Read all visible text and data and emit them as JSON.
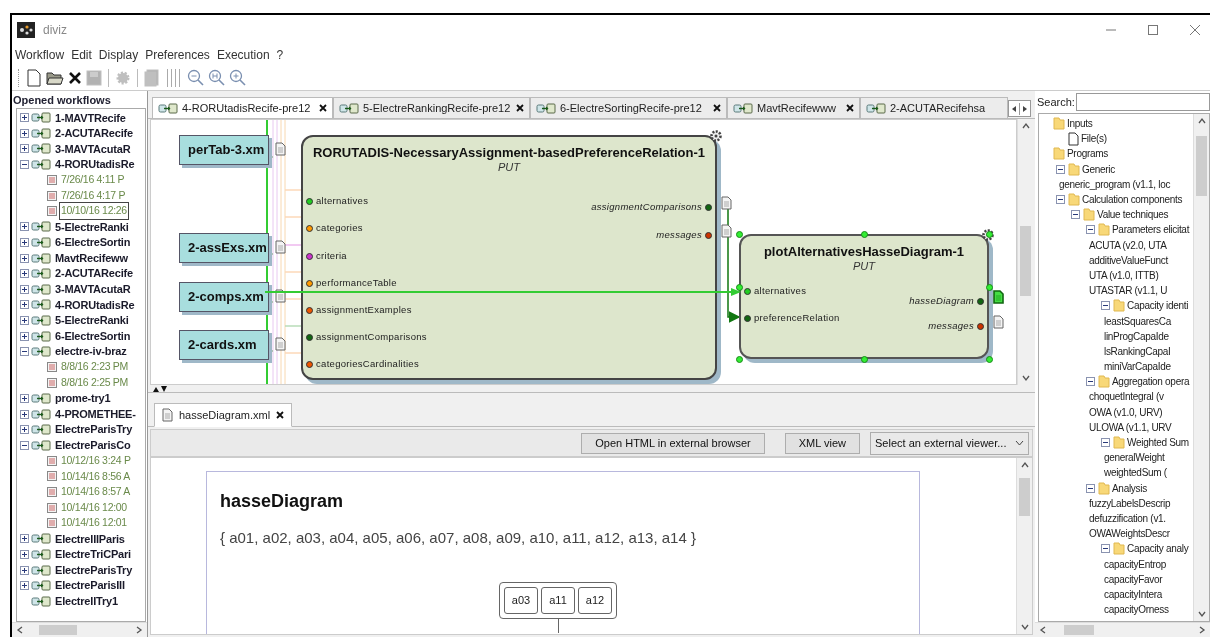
{
  "window": {
    "title": "diviz"
  },
  "menu": [
    "Workflow",
    "Edit",
    "Display",
    "Preferences",
    "Execution",
    "?"
  ],
  "toolbar": [
    {
      "kind": "new",
      "disabled": false
    },
    {
      "kind": "open",
      "disabled": false
    },
    {
      "kind": "close",
      "disabled": false
    },
    {
      "kind": "save",
      "disabled": true
    },
    {
      "kind": "run",
      "disabled": true
    },
    {
      "kind": "stamp",
      "disabled": true
    },
    {
      "kind": "zoom_out",
      "disabled": false
    },
    {
      "kind": "zoom_reset",
      "disabled": false
    },
    {
      "kind": "zoom_in",
      "disabled": false
    }
  ],
  "workflows": {
    "title": "Opened workflows",
    "items": [
      {
        "label": "1-MAVTRecife",
        "expanded": false
      },
      {
        "label": "2-ACUTARecife",
        "expanded": false
      },
      {
        "label": "3-MAVTAcutaR",
        "expanded": false
      },
      {
        "label": "4-RORUtadisRe",
        "expanded": true,
        "children": [
          {
            "label": "7/26/16 4:11 P",
            "selected": false
          },
          {
            "label": "7/26/16 4:17 P",
            "selected": false
          },
          {
            "label": "10/10/16 12:26",
            "selected": true
          }
        ]
      },
      {
        "label": "5-ElectreRanki",
        "expanded": false
      },
      {
        "label": "6-ElectreSortin",
        "expanded": false
      },
      {
        "label": "MavtRecifeww",
        "expanded": false
      },
      {
        "label": "2-ACUTARecife",
        "expanded": false
      },
      {
        "label": "3-MAVTAcutaR",
        "expanded": false
      },
      {
        "label": "4-RORUtadisRe",
        "expanded": false
      },
      {
        "label": "5-ElectreRanki",
        "expanded": false
      },
      {
        "label": "6-ElectreSortin",
        "expanded": false
      },
      {
        "label": "electre-iv-braz",
        "expanded": true,
        "children": [
          {
            "label": "8/8/16 2:23 PM",
            "selected": false
          },
          {
            "label": "8/8/16 2:25 PM",
            "selected": false
          }
        ]
      },
      {
        "label": "prome-try1",
        "expanded": false
      },
      {
        "label": "4-PROMETHEE-",
        "expanded": false
      },
      {
        "label": "ElectreParisTry",
        "expanded": false
      },
      {
        "label": "ElectreParisCo",
        "expanded": true,
        "children": [
          {
            "label": "10/12/16 3:24 P",
            "selected": false
          },
          {
            "label": "10/14/16 8:56 A",
            "selected": false
          },
          {
            "label": "10/14/16 8:57 A",
            "selected": false
          },
          {
            "label": "10/14/16 12:00",
            "selected": false
          },
          {
            "label": "10/14/16 12:01",
            "selected": false
          }
        ]
      },
      {
        "label": "ElectreIIIParis",
        "expanded": false
      },
      {
        "label": "ElectreTriCPari",
        "expanded": false
      },
      {
        "label": "ElectreParisTry",
        "expanded": false
      },
      {
        "label": "ElectreParisIII",
        "expanded": false
      },
      {
        "label": "ElectreIITry1"
      }
    ]
  },
  "editor": {
    "tabs": [
      {
        "label": "4-RORUtadisRecife-pre12",
        "selected": true,
        "closable": true
      },
      {
        "label": "5-ElectreRankingRecife-pre12",
        "selected": false,
        "closable": true
      },
      {
        "label": "6-ElectreSortingRecife-pre12",
        "selected": false,
        "closable": true
      },
      {
        "label": "MavtRecifewww",
        "selected": false,
        "closable": true
      },
      {
        "label": "2-ACUTARecifehsa",
        "selected": false,
        "closable": false
      }
    ]
  },
  "canvas": {
    "files": [
      {
        "label": "perTab-3.xm"
      },
      {
        "label": "2-assExs.xm"
      },
      {
        "label": "2-comps.xm"
      },
      {
        "label": "2-cards.xm"
      }
    ],
    "nodes": [
      {
        "title": "RORUTADIS-NecessaryAssignment-basedPreferenceRelation-1",
        "subtitle": "PUT",
        "selected": false,
        "inputs": [
          {
            "label": "alternatives",
            "color": "#22cc22"
          },
          {
            "label": "categories",
            "color": "#ff9900"
          },
          {
            "label": "criteria",
            "color": "#cc33cc"
          },
          {
            "label": "performanceTable",
            "color": "#ff9900"
          },
          {
            "label": "assignmentExamples",
            "color": "#ee5500"
          },
          {
            "label": "assignmentComparisons",
            "color": "#116611"
          },
          {
            "label": "categoriesCardinalities",
            "color": "#ee5500"
          }
        ],
        "outputs": [
          {
            "label": "assignmentComparisons",
            "color": "#116611",
            "selected": false
          },
          {
            "label": "messages",
            "color": "#cc3300",
            "selected": false
          }
        ]
      },
      {
        "title": "plotAlternativesHasseDiagram-1",
        "subtitle": "PUT",
        "selected": true,
        "inputs": [
          {
            "label": "alternatives",
            "color": "#22cc22"
          },
          {
            "label": "preferenceRelation",
            "color": "#116611"
          }
        ],
        "outputs": [
          {
            "label": "hasseDiagram",
            "color": "#116611",
            "selected": true
          },
          {
            "label": "messages",
            "color": "#cc3300",
            "selected": false
          }
        ]
      }
    ]
  },
  "viewer": {
    "tabs": [
      {
        "label": "hasseDiagram.xml",
        "selected": true
      }
    ],
    "buttons": [
      "Open HTML in external browser",
      "XML view"
    ],
    "viewer_select": {
      "value": "Select an external viewer..."
    }
  },
  "document": {
    "heading": "hasseDiagram",
    "set": "{ a01, a02, a03, a04, a05, a06, a07, a08, a09, a10, a11, a12, a13, a14 }",
    "diagram_nodes": [
      "a03",
      "a11",
      "a12"
    ]
  },
  "programs": {
    "search_label": "Search:",
    "items": [
      {
        "label": "Inputs",
        "kind": "folder",
        "children": [
          {
            "label": "File(s)",
            "kind": "file"
          }
        ]
      },
      {
        "label": "Programs",
        "kind": "folder",
        "children": [
          {
            "label": "Generic",
            "kind": "folder",
            "expanded": true,
            "children": [
              {
                "label": "generic_program (v1.1, loc",
                "kind": "program"
              }
            ]
          },
          {
            "label": "Calculation components",
            "kind": "folder",
            "expanded": true,
            "children": [
              {
                "label": "Value techniques",
                "kind": "folder",
                "expanded": true,
                "children": [
                  {
                    "label": "Parameters elicitat",
                    "kind": "folder",
                    "expanded": true,
                    "children": [
                      {
                        "label": "ACUTA (v2.0, UTA",
                        "kind": "program"
                      },
                      {
                        "label": "additiveValueFunct",
                        "kind": "program"
                      },
                      {
                        "label": "UTA (v1.0, ITTB)",
                        "kind": "program"
                      },
                      {
                        "label": "UTASTAR (v1.1, U",
                        "kind": "program"
                      },
                      {
                        "label": "Capacity identi",
                        "kind": "folder",
                        "expanded": true,
                        "children": [
                          {
                            "label": "leastSquaresCa",
                            "kind": "program"
                          },
                          {
                            "label": "linProgCapaIde",
                            "kind": "program"
                          },
                          {
                            "label": "lsRankingCapaI",
                            "kind": "program"
                          },
                          {
                            "label": "miniVarCapaIde",
                            "kind": "program"
                          }
                        ]
                      }
                    ]
                  },
                  {
                    "label": "Aggregation opera",
                    "kind": "folder",
                    "expanded": true,
                    "children": [
                      {
                        "label": "choquetIntegral (v",
                        "kind": "program"
                      },
                      {
                        "label": "OWA (v1.0, URV)",
                        "kind": "program"
                      },
                      {
                        "label": "ULOWA (v1.1, URV",
                        "kind": "program"
                      },
                      {
                        "label": "Weighted Sum",
                        "kind": "folder",
                        "expanded": true,
                        "children": [
                          {
                            "label": "generalWeight",
                            "kind": "program"
                          },
                          {
                            "label": "weightedSum (",
                            "kind": "program"
                          }
                        ]
                      }
                    ]
                  },
                  {
                    "label": "Analysis",
                    "kind": "folder",
                    "expanded": true,
                    "children": [
                      {
                        "label": "fuzzyLabelsDescrip",
                        "kind": "program"
                      },
                      {
                        "label": "defuzzification (v1.",
                        "kind": "program"
                      },
                      {
                        "label": "OWAWeightsDescr",
                        "kind": "program"
                      },
                      {
                        "label": "Capacity analy",
                        "kind": "folder",
                        "expanded": true,
                        "children": [
                          {
                            "label": "capacityEntrop",
                            "kind": "program"
                          },
                          {
                            "label": "capacityFavor",
                            "kind": "program"
                          },
                          {
                            "label": "capacityIntera",
                            "kind": "program"
                          },
                          {
                            "label": "capacityOrness",
                            "kind": "program"
                          }
                        ]
                      }
                    ]
                  }
                ]
              }
            ]
          }
        ]
      }
    ]
  }
}
